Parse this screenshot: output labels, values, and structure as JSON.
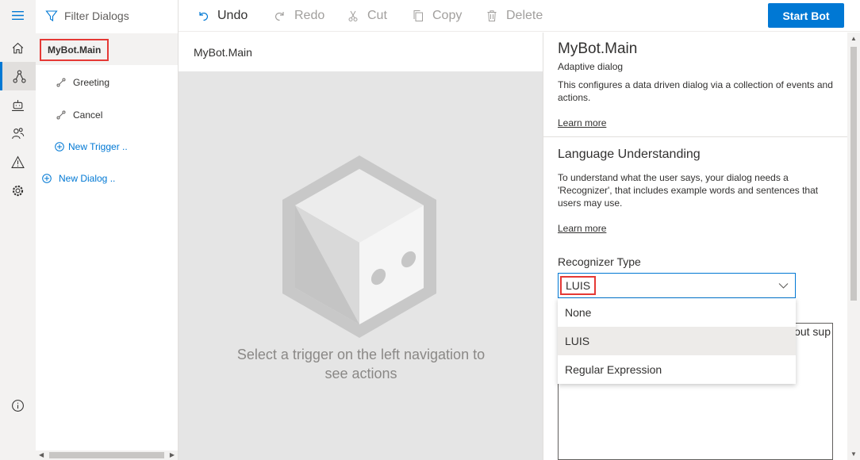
{
  "nav": {
    "items": [
      {
        "icon": "home-icon",
        "active": false
      },
      {
        "icon": "design-flow-icon",
        "active": true
      },
      {
        "icon": "bot-responses-icon",
        "active": false
      },
      {
        "icon": "user-input-icon",
        "active": false
      },
      {
        "icon": "notifications-icon",
        "active": false
      },
      {
        "icon": "settings-icon",
        "active": false
      }
    ],
    "bottom_icon": "info-icon"
  },
  "tree": {
    "filter_label": "Filter Dialogs",
    "root_dialog": "MyBot.Main",
    "triggers": [
      "Greeting",
      "Cancel"
    ],
    "new_trigger": "New Trigger ..",
    "new_dialog": "New Dialog .."
  },
  "toolbar": {
    "undo": "Undo",
    "redo": "Redo",
    "cut": "Cut",
    "copy": "Copy",
    "delete": "Delete",
    "start_bot": "Start Bot"
  },
  "canvas": {
    "header": "MyBot.Main",
    "empty_message": "Select a trigger on the left navigation to see actions"
  },
  "properties": {
    "title": "MyBot.Main",
    "subtitle": "Adaptive dialog",
    "description": "This configures a data driven dialog via a collection of events and actions.",
    "learn_more": "Learn more",
    "lu_heading": "Language Understanding",
    "lu_description": "To understand what the user says, your dialog needs a 'Recognizer', that includes example words and sentences that users may use.",
    "lu_learn_more": "Learn more",
    "recognizer_label": "Recognizer Type",
    "recognizer_value": "LUIS",
    "options": [
      "None",
      "LUIS",
      "Regular Expression"
    ],
    "selected_option": "LUIS",
    "partial_text": "out sup"
  },
  "colors": {
    "accent": "#0078d4",
    "highlight_border": "#e53935",
    "canvas_bg": "#e5e5e5"
  }
}
